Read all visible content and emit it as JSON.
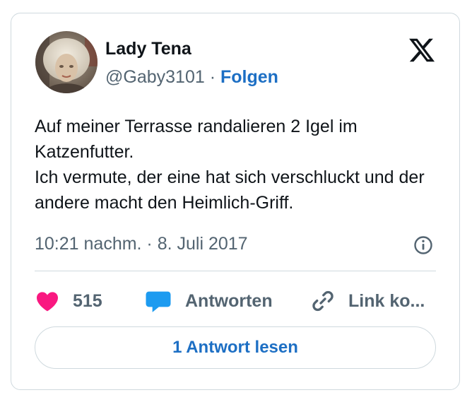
{
  "author": {
    "name": "Lady Tena",
    "handle": "@Gaby3101",
    "separator": "·",
    "follow_label": "Folgen"
  },
  "tweet": {
    "text_lines": [
      "Auf meiner Terrasse randalieren 2 Igel im Katzenfutter.",
      "Ich vermute, der eine hat sich verschluckt und der andere macht den Heimlich-Griff."
    ],
    "timestamp": "10:21 nachm. · 8. Juli 2017"
  },
  "actions": {
    "likes_count": "515",
    "reply_label": "Antworten",
    "copy_link_label": "Link ko..."
  },
  "read_replies_label": "1 Antwort lesen",
  "icons": {
    "logo": "x-logo-icon",
    "info": "info-icon",
    "like": "heart-icon",
    "reply": "speech-bubble-icon",
    "link": "link-icon"
  },
  "colors": {
    "heart": "#f91880",
    "reply_bubble": "#1d9bf0",
    "link_blue": "#1d6fc4",
    "muted_text": "#536471",
    "border": "#cfd9de"
  }
}
